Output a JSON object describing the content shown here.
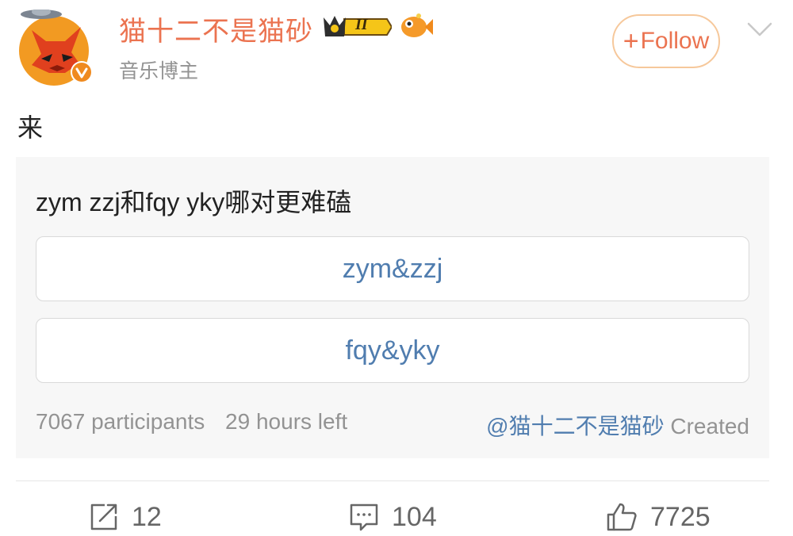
{
  "header": {
    "username": "猫十二不是猫砂",
    "subtitle": "音乐博主",
    "follow_label": "Follow",
    "follow_plus": "+",
    "badge_numeral": "II"
  },
  "post": {
    "text": "来"
  },
  "poll": {
    "question": "zym zzj和fqy yky哪对更难磕",
    "options": [
      {
        "label": "zym&zzj"
      },
      {
        "label": "fqy&yky"
      }
    ],
    "participants": "7067 participants",
    "time_left": "29 hours left",
    "creator_mention": "@猫十二不是猫砂",
    "creator_suffix": "Created"
  },
  "actions": {
    "reposts": "12",
    "comments": "104",
    "likes": "7725"
  },
  "colors": {
    "username": "#eb7350",
    "link": "#507daf",
    "muted": "#939393",
    "card_bg": "#f7f7f7",
    "follow_border": "#f6c89b"
  },
  "icons": [
    "avatar-fox",
    "crown-badge-icon",
    "fish-badge-icon",
    "verified-icon",
    "chevron-down-icon",
    "repost-icon",
    "comment-icon",
    "like-icon"
  ]
}
